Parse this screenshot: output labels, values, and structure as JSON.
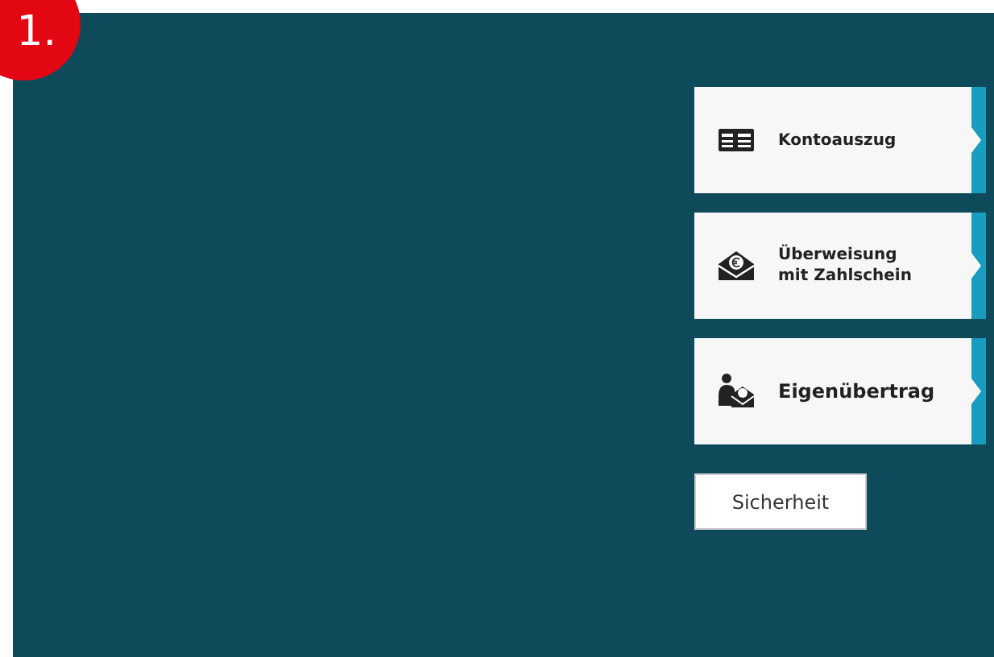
{
  "step_badge": "1.",
  "menu_buttons": [
    {
      "kind": "statement",
      "label": "Kontoauszug"
    },
    {
      "kind": "transfer",
      "label": "Überweisung\nmit Zahlschein"
    },
    {
      "kind": "own-transfer",
      "label": "Eigenübertrag"
    }
  ],
  "secondary_button": "Sicherheit"
}
